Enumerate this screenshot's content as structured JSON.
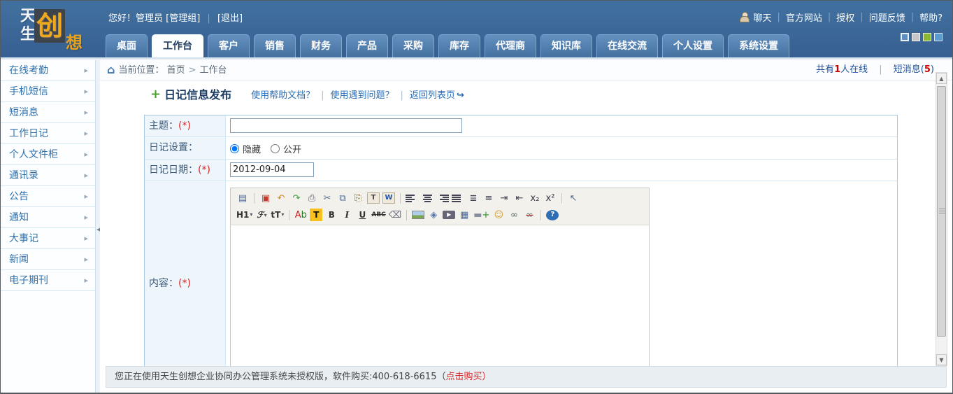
{
  "header": {
    "logo": {
      "c1": "天",
      "c2": "生",
      "c3": "创",
      "c4": "想"
    },
    "greeting": "您好！管理员 [管理组]",
    "logout": "[退出]",
    "top_links": [
      {
        "label": "聊天",
        "name": "chat-link"
      },
      {
        "label": "官方网站",
        "name": "official-site-link"
      },
      {
        "label": "授权",
        "name": "license-link"
      },
      {
        "label": "问题反馈",
        "name": "feedback-link"
      },
      {
        "label": "帮助?",
        "name": "help-link"
      }
    ],
    "theme_swatches": [
      {
        "name": "theme-blue-selected",
        "color": "#5b8fc2",
        "selected": true
      },
      {
        "name": "theme-gray",
        "color": "#c6c6c6",
        "selected": false
      },
      {
        "name": "theme-green",
        "color": "#8ab833",
        "selected": false
      },
      {
        "name": "theme-lightblue",
        "color": "#5b9bd0",
        "selected": false
      }
    ]
  },
  "tabs": {
    "items": [
      {
        "label": "桌面",
        "name": "tab-desktop",
        "active": false
      },
      {
        "label": "工作台",
        "name": "tab-workbench",
        "active": true
      },
      {
        "label": "客户",
        "name": "tab-customers",
        "active": false
      },
      {
        "label": "销售",
        "name": "tab-sales",
        "active": false
      },
      {
        "label": "财务",
        "name": "tab-finance",
        "active": false
      },
      {
        "label": "产品",
        "name": "tab-products",
        "active": false
      },
      {
        "label": "采购",
        "name": "tab-purchasing",
        "active": false
      },
      {
        "label": "库存",
        "name": "tab-inventory",
        "active": false
      },
      {
        "label": "代理商",
        "name": "tab-agents",
        "active": false
      },
      {
        "label": "知识库",
        "name": "tab-knowledge-base",
        "active": false
      },
      {
        "label": "在线交流",
        "name": "tab-online-chat",
        "active": false
      },
      {
        "label": "个人设置",
        "name": "tab-personal-settings",
        "active": false
      },
      {
        "label": "系统设置",
        "name": "tab-system-settings",
        "active": false
      }
    ]
  },
  "sidebar": {
    "arrow_glyph": "▸",
    "collapse_glyph": "◂",
    "items": [
      {
        "label": "在线考勤",
        "name": "sidebar-item-online-attendance"
      },
      {
        "label": "手机短信",
        "name": "sidebar-item-mobile-sms"
      },
      {
        "label": "短消息",
        "name": "sidebar-item-short-message"
      },
      {
        "label": "工作日记",
        "name": "sidebar-item-work-diary"
      },
      {
        "label": "个人文件柜",
        "name": "sidebar-item-personal-files"
      },
      {
        "label": "通讯录",
        "name": "sidebar-item-contacts"
      },
      {
        "label": "公告",
        "name": "sidebar-item-announcements"
      },
      {
        "label": "通知",
        "name": "sidebar-item-notices"
      },
      {
        "label": "大事记",
        "name": "sidebar-item-milestones"
      },
      {
        "label": "新闻",
        "name": "sidebar-item-news"
      },
      {
        "label": "电子期刊",
        "name": "sidebar-item-e-journal"
      }
    ]
  },
  "breadcrumb": {
    "home_glyph": "⌂",
    "label": "当前位置：",
    "crumbs": [
      "首页",
      "工作台"
    ],
    "online_prefix": "共有",
    "online_count": "1",
    "online_suffix": "人在线",
    "msg_prefix": "短消息(",
    "msg_count": "5",
    "msg_suffix": ")"
  },
  "main": {
    "plus_glyph": "+",
    "title": "日记信息发布",
    "return_arrow_glyph": "↪",
    "help_links": [
      {
        "label": "使用帮助文档？",
        "name": "help-doc-link",
        "arrow": false
      },
      {
        "label": "使用遇到问题？",
        "name": "problem-help-link",
        "arrow": false
      },
      {
        "label": "返回列表页",
        "name": "back-to-list-link",
        "arrow": true
      }
    ],
    "form": {
      "required": "(*)",
      "subject_label": "主题：",
      "subject_value": "",
      "setting_label": "日记设置：",
      "radio_options": [
        {
          "label": "隐藏",
          "name": "radio-hidden",
          "checked": true
        },
        {
          "label": "公开",
          "name": "radio-public",
          "checked": false
        }
      ],
      "date_label": "日记日期：",
      "date_value": "2012-09-04",
      "content_label": "内容："
    },
    "editor": {
      "toolbar_row1": [
        {
          "name": "source-icon",
          "glyph": "▤",
          "color": "#55709a"
        },
        {
          "sep": true
        },
        {
          "name": "fullscreen-icon",
          "glyph": "▣",
          "color": "#c0392b"
        },
        {
          "name": "undo-icon",
          "glyph": "↶",
          "color": "#d4881c"
        },
        {
          "name": "redo-icon",
          "glyph": "↷",
          "color": "#3f9e3f"
        },
        {
          "name": "print-icon",
          "glyph": "⎙",
          "color": "#556"
        },
        {
          "name": "cut-icon",
          "glyph": "✂",
          "color": "#556a8a"
        },
        {
          "name": "copy-icon",
          "glyph": "⧉",
          "color": "#4a6b9a"
        },
        {
          "name": "paste-icon",
          "glyph": "⎘",
          "color": "#8a6d3b"
        },
        {
          "name": "paste-text-icon",
          "glyph": "T",
          "class": "boxed"
        },
        {
          "name": "paste-word-icon",
          "glyph": "W",
          "class": "boxed blue"
        },
        {
          "sep": true
        },
        {
          "name": "align-left-icon",
          "class": "bars"
        },
        {
          "name": "align-center-icon",
          "class": "bars b-center"
        },
        {
          "name": "align-right-icon",
          "class": "bars b-right"
        },
        {
          "name": "justify-icon",
          "class": "bars b-just"
        },
        {
          "name": "ordered-list-icon",
          "glyph": "≣",
          "color": "#445"
        },
        {
          "name": "unordered-list-icon",
          "glyph": "≡",
          "color": "#445"
        },
        {
          "name": "indent-icon",
          "glyph": "⇥",
          "color": "#445"
        },
        {
          "name": "outdent-icon",
          "glyph": "⇤",
          "color": "#445"
        },
        {
          "name": "subscript-icon",
          "glyph": "x₂",
          "color": "#334"
        },
        {
          "name": "superscript-icon",
          "glyph": "x²",
          "color": "#334"
        },
        {
          "sep": true
        },
        {
          "name": "select-cursor-icon",
          "glyph": "↖",
          "color": "#556a8a"
        }
      ],
      "toolbar_row2": [
        {
          "name": "heading-icon",
          "glyph": "H1",
          "class": "txt",
          "caret": true
        },
        {
          "name": "font-family-icon",
          "glyph": "ℱ",
          "class": "txt ital",
          "caret": true
        },
        {
          "name": "font-size-icon",
          "glyph": "tT",
          "class": "txt",
          "caret": true
        },
        {
          "sep": true
        },
        {
          "name": "text-color-icon",
          "parts": [
            {
              "t": "A",
              "c": "#cc2222"
            },
            {
              "t": "b",
              "c": "#227722"
            }
          ]
        },
        {
          "name": "highlight-color-icon",
          "glyph": "T",
          "class": "hl"
        },
        {
          "name": "bold-icon",
          "glyph": "B",
          "class": "txt"
        },
        {
          "name": "italic-icon",
          "glyph": "I",
          "class": "txt ital"
        },
        {
          "name": "underline-icon",
          "glyph": "U",
          "class": "txt und"
        },
        {
          "name": "strikethrough-icon",
          "glyph": "ABC",
          "class": "txt strike"
        },
        {
          "name": "eraser-icon",
          "glyph": "⌫",
          "color": "#667"
        },
        {
          "sep": true
        },
        {
          "name": "insert-image-icon",
          "class": "pic"
        },
        {
          "name": "insert-media-icon",
          "glyph": "◈",
          "color": "#5577aa"
        },
        {
          "name": "insert-video-icon",
          "glyph": "▶",
          "class": "vid"
        },
        {
          "name": "insert-table-icon",
          "glyph": "▦",
          "color": "#4a6b9a"
        },
        {
          "name": "horizontal-rule-icon",
          "parts": [
            {
              "t": "▬",
              "c": "#8890a0"
            },
            {
              "t": "+",
              "c": "#2a8f2a"
            }
          ]
        },
        {
          "name": "smiley-icon",
          "glyph": "☺",
          "color": "#d69e2e"
        },
        {
          "name": "link-icon",
          "glyph": "∞",
          "color": "#566"
        },
        {
          "name": "unlink-icon",
          "glyph": "∞",
          "class": "unlink",
          "color": "#566"
        },
        {
          "sep": true
        },
        {
          "name": "editor-help-icon",
          "glyph": "?",
          "class": "help"
        }
      ]
    }
  },
  "footer": {
    "text_prefix": "您正在使用天生创想企业协同办公管理系统未授权版，软件购买:400-618-6615（",
    "buy_link": "点击购买",
    "text_suffix": "）"
  }
}
